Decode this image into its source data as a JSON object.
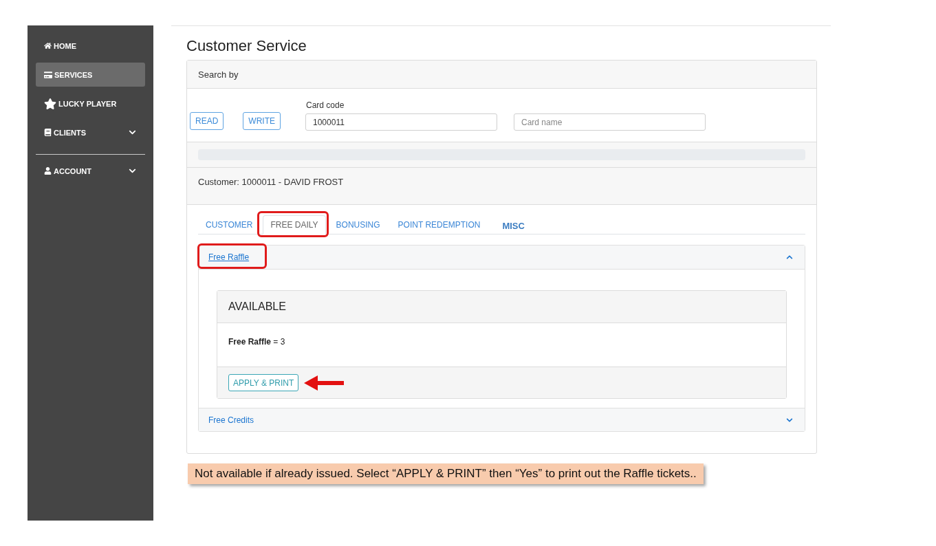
{
  "sidebar": {
    "sections": [
      {
        "items": [
          {
            "kind": "link",
            "label": "HOME",
            "selected": false
          },
          {
            "kind": "link",
            "label": "SERVICES",
            "selected": true
          },
          {
            "kind": "link",
            "label": "LUCKY PLAYER",
            "selected": false
          },
          {
            "kind": "menu",
            "label": "CLIENTS",
            "selected": false,
            "expanded": false
          }
        ]
      },
      {
        "items": [
          {
            "kind": "menu",
            "label": "ACCOUNT",
            "selected": false,
            "expanded": false
          }
        ]
      }
    ]
  },
  "page_title": "Customer Service",
  "search_panel": {
    "title": "Search by",
    "buttons": [
      "READ",
      "WRITE"
    ],
    "card_code": {
      "label": "Card code",
      "value": "1000011"
    },
    "card_name": {
      "placeholder": "Card name"
    }
  },
  "customer_panel": {
    "title": "Customer: 1000011 - DAVID FROST",
    "tabs": [
      {
        "label": "CUSTOMER",
        "selected": false,
        "highlighted": false,
        "emphasized": false
      },
      {
        "label": "FREE DAILY",
        "selected": true,
        "highlighted": true,
        "emphasized": false
      },
      {
        "label": "BONUSING",
        "selected": false,
        "highlighted": false,
        "emphasized": false
      },
      {
        "label": "POINT REDEMPTION",
        "selected": false,
        "highlighted": false,
        "emphasized": false
      },
      {
        "label": "MISC",
        "selected": false,
        "highlighted": false,
        "emphasized": true
      }
    ],
    "accordion": [
      {
        "title": "Free Raffle",
        "expanded": true,
        "focused": true,
        "highlighted": true,
        "content": {
          "title": "AVAILABLE",
          "line": "**Free Raffle** = 3",
          "button": "APPLY & PRINT",
          "arrow": true
        }
      },
      {
        "title": "Free Credits",
        "expanded": false,
        "focused": false,
        "highlighted": false
      }
    ]
  },
  "note": "Not available if already issued. Select “APPLY & PRINT” then “Yes” to print out the Raffle tickets.."
}
